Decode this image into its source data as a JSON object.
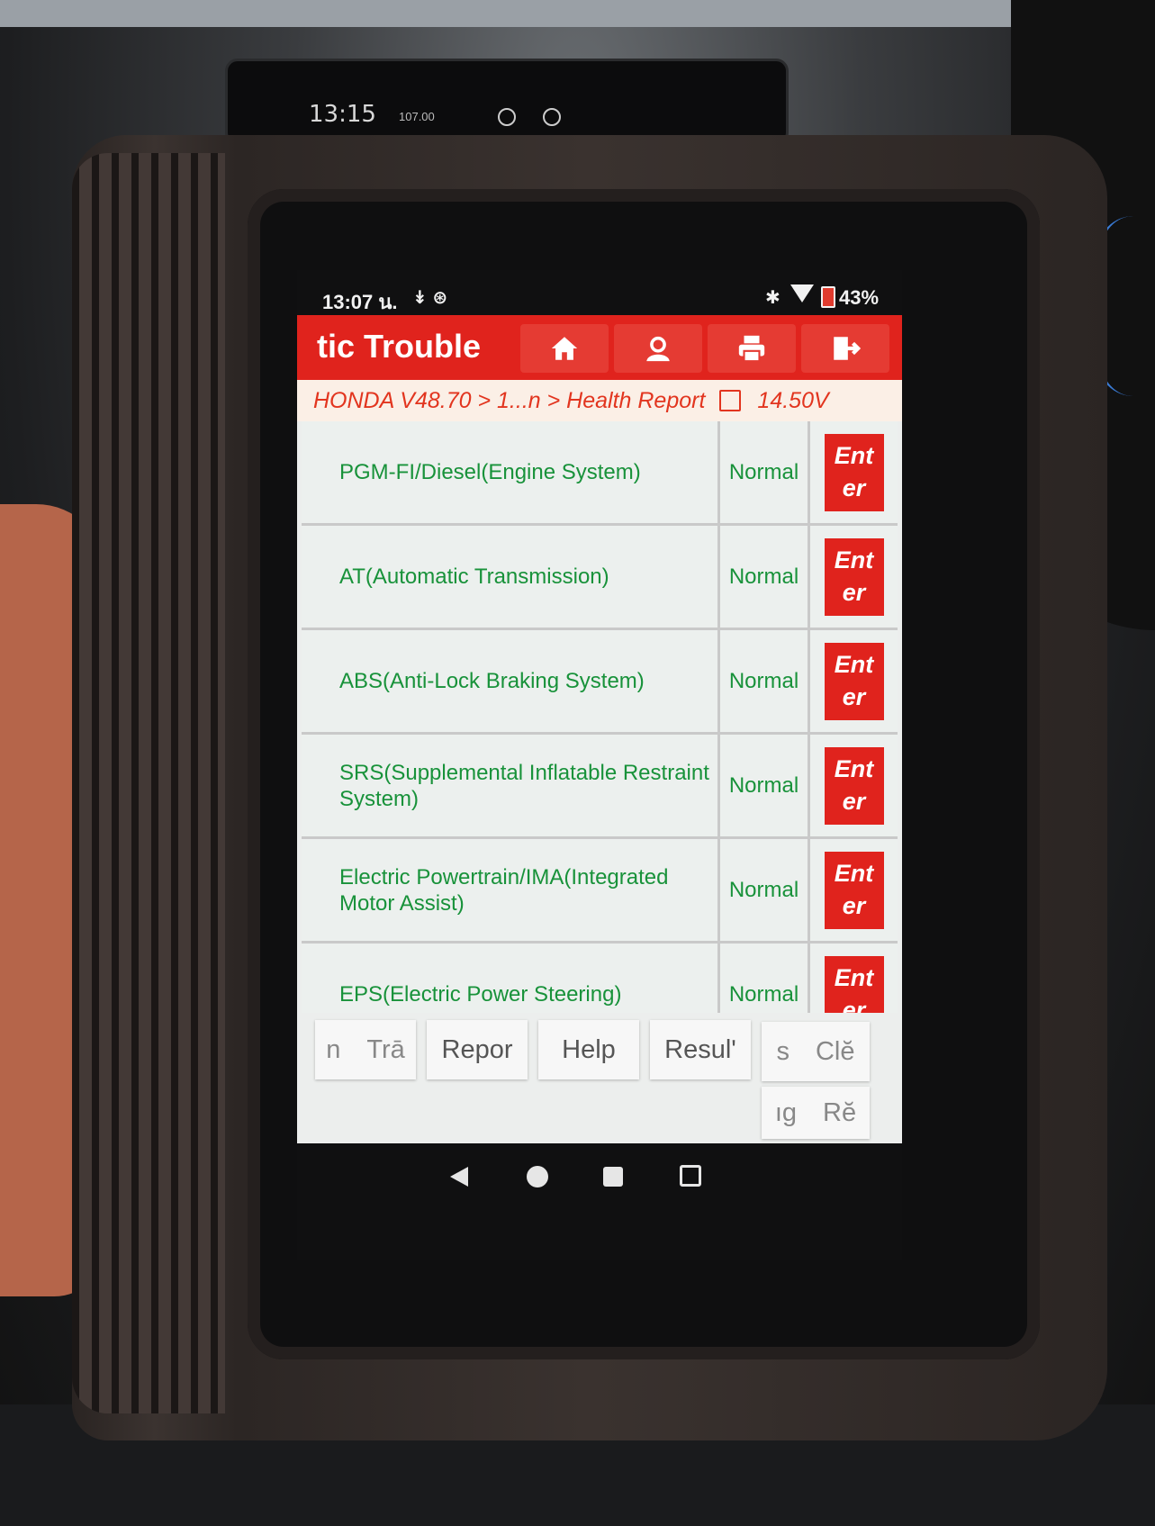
{
  "car_display": {
    "time": "13:15",
    "radio": "107.00"
  },
  "status_bar": {
    "time": "13:07 น.",
    "icons": "↡ ⊛",
    "bluetooth": "✱",
    "battery": "43%"
  },
  "app": {
    "title": "tic Trouble",
    "toolbar": [
      "home-icon",
      "support-icon",
      "print-icon",
      "exit-icon"
    ],
    "breadcrumb": "HONDA V48.70 > 1...n > Health Report",
    "voltage": "14.50V",
    "rows": [
      {
        "system": "PGM-FI/Diesel(Engine System)",
        "status": "Normal",
        "action": "Enter"
      },
      {
        "system": "AT(Automatic Transmission)",
        "status": "Normal",
        "action": "Enter"
      },
      {
        "system": "ABS(Anti-Lock Braking System)",
        "status": "Normal",
        "action": "Enter"
      },
      {
        "system": "SRS(Supplemental Inflatable Restraint System)",
        "status": "Normal",
        "action": "Enter"
      },
      {
        "system": "Electric Powertrain/IMA(Integrated Motor Assist)",
        "status": "Normal",
        "action": "Enter"
      },
      {
        "system": "EPS(Electric Power Steering)",
        "status": "Normal",
        "action": "Enter"
      }
    ],
    "enter_line1": "Ent",
    "enter_line2": "er",
    "bottom_buttons": {
      "b1": "n Trā",
      "b2": "Repor",
      "b3": "Help",
      "b4": "Resulʹ",
      "b5": "s Clĕ",
      "b6": "ıg Rĕ"
    }
  },
  "colors": {
    "accent": "#e0231d",
    "status_text": "#18923a",
    "breadcrumb_text": "#e2351f"
  }
}
